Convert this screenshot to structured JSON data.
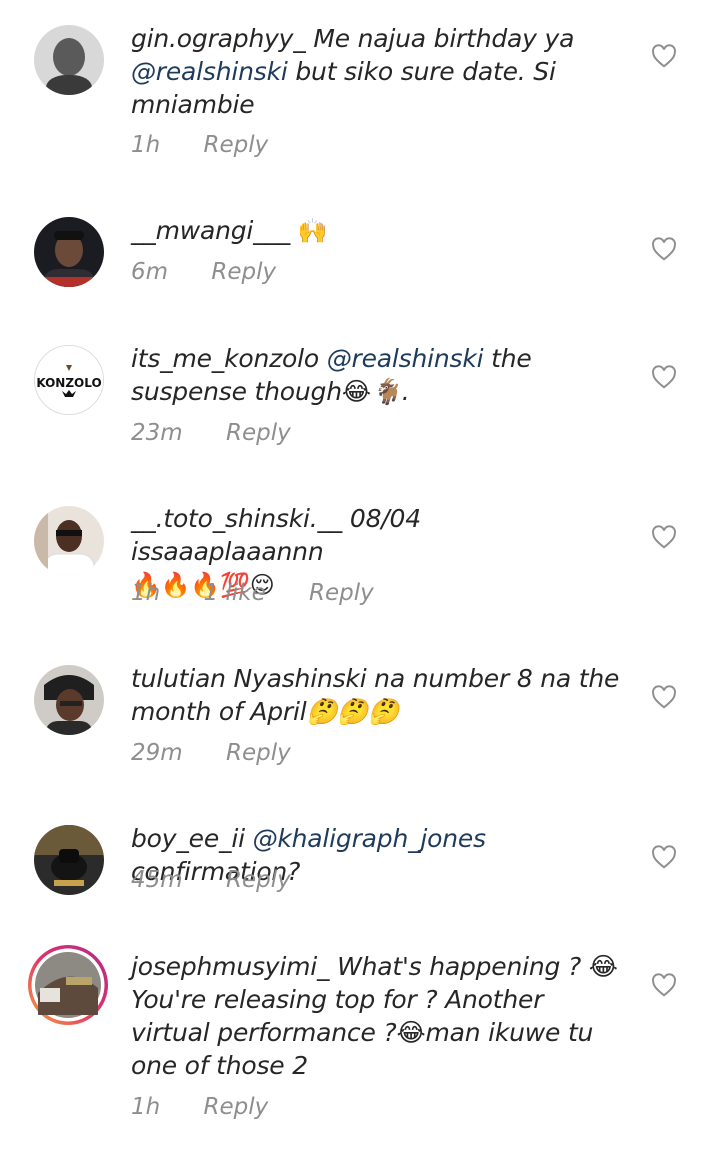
{
  "comments": [
    {
      "user": "gin.ographyy_",
      "pre": "Me najua birthday ya",
      "mention": "@realshinski",
      "post": "but siko sure date. Si mniambie",
      "time": "1h",
      "reply": "Reply"
    },
    {
      "user": "__mwangi___",
      "text": "🙌",
      "time": "6m",
      "reply": "Reply"
    },
    {
      "user": "its_me_konzolo",
      "mention": "@realshinski",
      "post": "the suspense though😂🐐.",
      "time": "23m",
      "reply": "Reply",
      "avatar_text": "KONZOLO"
    },
    {
      "user": "__.toto_shinski.__",
      "text": "08/04 issaaaplaaannn",
      "emojis": "🔥🔥🔥💯😌",
      "time": "1h",
      "likes": "1 like",
      "reply": "Reply"
    },
    {
      "user": "tulutian",
      "text": "Nyashinski na number 8 na the month of April🤔🤔🤔",
      "time": "29m",
      "reply": "Reply"
    },
    {
      "user": "boy_ee_ii",
      "mention": "@khaligraph_jones",
      "post": "confirmation?",
      "time": "45m",
      "reply": "Reply"
    },
    {
      "user": "josephmusyimi_",
      "text": "What's happening ? 😂 You're releasing top for ? Another virtual performance ?😂man ikuwe tu one of those 2",
      "time": "1h",
      "reply": "Reply"
    }
  ],
  "colors": {
    "mention": "#1f3b5c",
    "meta": "#8e8e8e",
    "text": "#262626"
  }
}
